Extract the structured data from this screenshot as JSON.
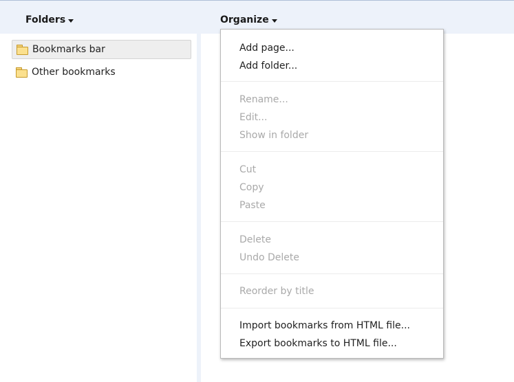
{
  "header": {
    "folders_label": "Folders",
    "organize_label": "Organize"
  },
  "folders": [
    {
      "label": "Bookmarks bar",
      "selected": true
    },
    {
      "label": "Other bookmarks",
      "selected": false
    }
  ],
  "organize_menu": {
    "groups": [
      [
        {
          "label": "Add page...",
          "enabled": true
        },
        {
          "label": "Add folder...",
          "enabled": true
        }
      ],
      [
        {
          "label": "Rename...",
          "enabled": false
        },
        {
          "label": "Edit...",
          "enabled": false
        },
        {
          "label": "Show in folder",
          "enabled": false
        }
      ],
      [
        {
          "label": "Cut",
          "enabled": false
        },
        {
          "label": "Copy",
          "enabled": false
        },
        {
          "label": "Paste",
          "enabled": false
        }
      ],
      [
        {
          "label": "Delete",
          "enabled": false
        },
        {
          "label": "Undo Delete",
          "enabled": false
        }
      ],
      [
        {
          "label": "Reorder by title",
          "enabled": false
        }
      ],
      [
        {
          "label": "Import bookmarks from HTML file...",
          "enabled": true
        },
        {
          "label": "Export bookmarks to HTML file...",
          "enabled": true
        }
      ]
    ]
  },
  "colors": {
    "header_bg": "#edf2fa",
    "enabled_text": "#1f1f1f",
    "disabled_text": "#a9a9a9",
    "folder_fill": "#fbe08e"
  }
}
